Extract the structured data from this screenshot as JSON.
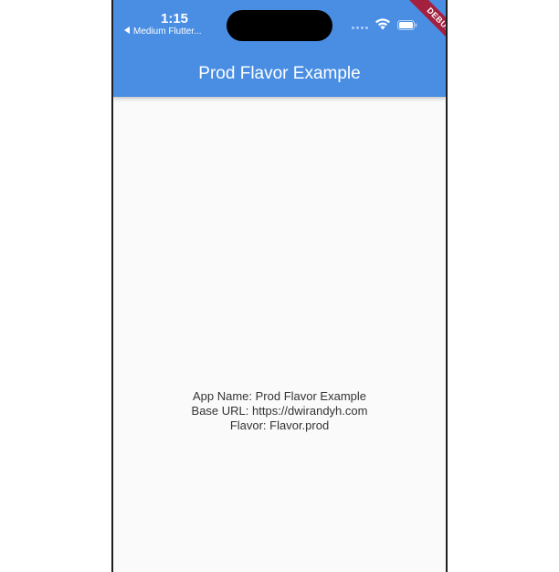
{
  "status_bar": {
    "time": "1:15",
    "back_app": "Medium Flutter..."
  },
  "debug_banner": {
    "label": "DEBUG"
  },
  "app_bar": {
    "title": "Prod Flavor Example"
  },
  "body": {
    "lines": [
      "App Name: Prod Flavor Example",
      "Base URL: https://dwirandyh.com",
      "Flavor: Flavor.prod"
    ]
  },
  "colors": {
    "app_bar": "#4a8ee4",
    "background": "#fafafa",
    "debug_banner": "#a3213f",
    "body_text": "#333333"
  },
  "icons": [
    "back-arrow-icon",
    "signal-dots-icon",
    "wifi-icon",
    "battery-icon"
  ]
}
